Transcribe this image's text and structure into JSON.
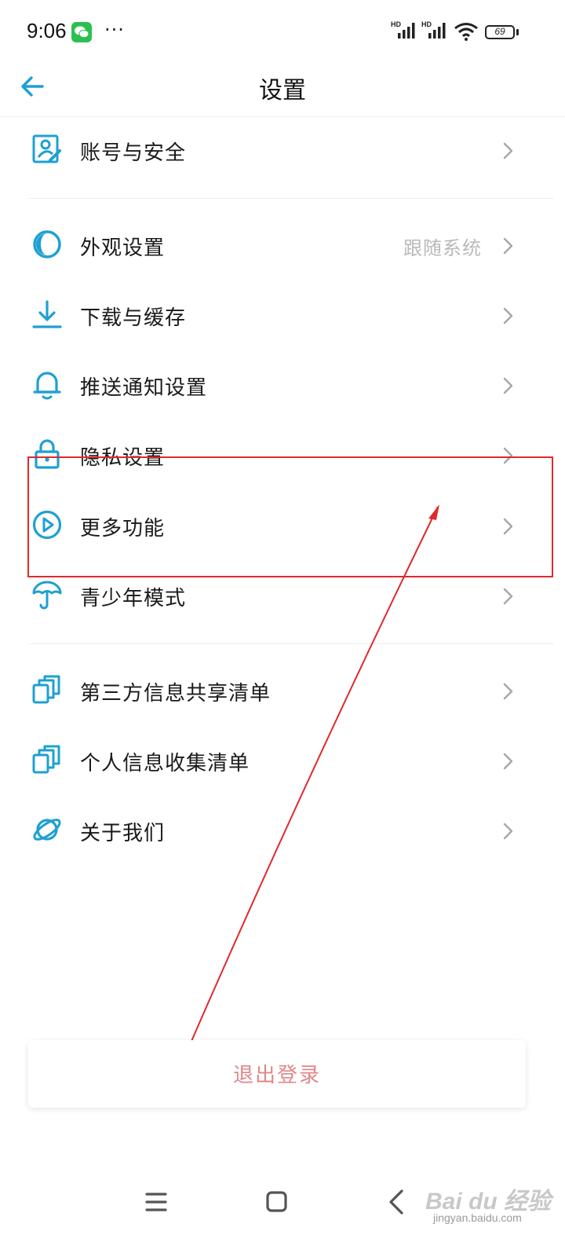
{
  "status_bar": {
    "time": "9:06",
    "more": "···",
    "sim1_label": "HD",
    "sim2_label": "HD",
    "battery": "69"
  },
  "header": {
    "title": "设置"
  },
  "settings": {
    "groups": [
      [
        {
          "label": "账号与安全",
          "icon": "account-security-icon",
          "value": ""
        }
      ],
      [
        {
          "label": "外观设置",
          "icon": "appearance-icon",
          "value": "跟随系统"
        },
        {
          "label": "下载与缓存",
          "icon": "download-icon",
          "value": ""
        },
        {
          "label": "推送通知设置",
          "icon": "bell-icon",
          "value": ""
        },
        {
          "label": "隐私设置",
          "icon": "lock-icon",
          "value": ""
        },
        {
          "label": "更多功能",
          "icon": "play-circle-icon",
          "value": ""
        },
        {
          "label": "青少年模式",
          "icon": "umbrella-icon",
          "value": ""
        }
      ],
      [
        {
          "label": "第三方信息共享清单",
          "icon": "copy-list-icon",
          "value": ""
        },
        {
          "label": "个人信息收集清单",
          "icon": "copy-list-icon",
          "value": ""
        },
        {
          "label": "关于我们",
          "icon": "planet-icon",
          "value": ""
        }
      ]
    ]
  },
  "logout": {
    "label": "退出登录"
  },
  "navbar": {
    "menu_icon": "menu-icon",
    "home_icon": "home-square-icon",
    "back_icon": "back-chevron-icon"
  },
  "watermark": {
    "brand": "Bai du 经验",
    "url": "jingyan.baidu.com"
  },
  "colors": {
    "accent": "#1ea0d2",
    "annotation": "#e0292c",
    "logout_text": "#e0878a",
    "secondary_text": "#b9b9b9"
  }
}
